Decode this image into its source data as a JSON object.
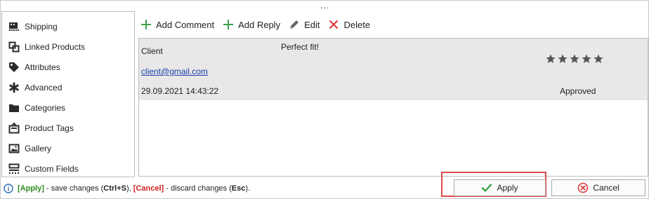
{
  "top_splitter": {
    "dots": "..."
  },
  "sidebar": {
    "items": [
      {
        "label": "Shipping",
        "icon": "truck-icon"
      },
      {
        "label": "Linked Products",
        "icon": "link-icon"
      },
      {
        "label": "Attributes",
        "icon": "tag-icon"
      },
      {
        "label": "Advanced",
        "icon": "asterisk-icon"
      },
      {
        "label": "Categories",
        "icon": "folder-icon"
      },
      {
        "label": "Product Tags",
        "icon": "tags-icon"
      },
      {
        "label": "Gallery",
        "icon": "image-icon"
      },
      {
        "label": "Custom Fields",
        "icon": "custom-fields-icon"
      }
    ]
  },
  "toolbar": {
    "add_comment": "Add Comment",
    "add_reply": "Add Reply",
    "edit": "Edit",
    "delete": "Delete"
  },
  "comments": [
    {
      "author": "Client",
      "email": "client@gmail.com",
      "date": "29.09.2021 14:43:22",
      "text": "Perfect fit!",
      "rating": 5,
      "status": "Approved"
    }
  ],
  "footer": {
    "apply_tag": "[Apply]",
    "apply_desc": " - save changes (",
    "apply_key": "Ctrl+S",
    "apply_end": "), ",
    "cancel_tag": "[Cancel]",
    "cancel_desc": " - discard changes (",
    "cancel_key": "Esc",
    "cancel_end": ")."
  },
  "buttons": {
    "apply": "Apply",
    "cancel": "Cancel"
  },
  "colors": {
    "green": "#2a8a1f",
    "red": "#d02020",
    "highlight": "#e04848",
    "row_bg": "#e8e8e8",
    "link": "#1a3fa8"
  }
}
